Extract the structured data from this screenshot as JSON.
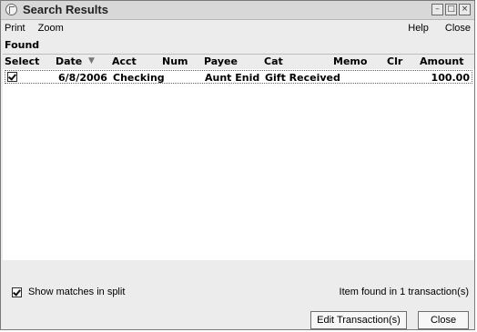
{
  "window": {
    "title": "Search Results"
  },
  "menu": {
    "left": [
      "Print",
      "Zoom"
    ],
    "right": [
      "Help",
      "Close"
    ]
  },
  "found_label": "Found",
  "table": {
    "columns": [
      "Select",
      "Date",
      "Acct",
      "Num",
      "Payee",
      "Cat",
      "Memo",
      "Clr",
      "Amount"
    ],
    "sort_indicator": "▼",
    "rows": [
      {
        "selected": true,
        "date": "6/8/2006",
        "acct": "Checking",
        "num": "",
        "payee": "Aunt Enid",
        "cat": "Gift Received",
        "memo": "",
        "clr": "",
        "amount": "100.00"
      }
    ]
  },
  "options": {
    "show_matches_in_split": true,
    "show_matches_label": "Show matches in split"
  },
  "status_text": "Item found in 1 transaction(s)",
  "buttons": {
    "edit": "Edit Transaction(s)",
    "close": "Close"
  },
  "icons": {
    "app_icon": "app-icon",
    "minimize_icon": "minimize-icon",
    "restore_icon": "restore-icon",
    "close_icon": "close-window-icon",
    "sort_icon": "sort-descending-icon",
    "checkbox_icon": "checkbox-checked-icon"
  }
}
